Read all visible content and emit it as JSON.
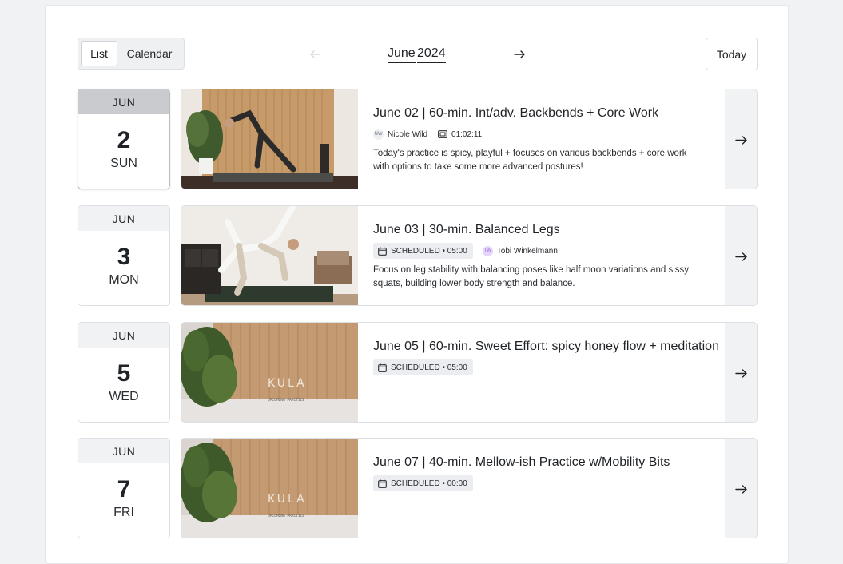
{
  "toolbar": {
    "view_list": "List",
    "view_calendar": "Calendar",
    "month": "June",
    "year": "2024",
    "today": "Today"
  },
  "colors": {
    "page_bg": "#f1f2f4",
    "selected_month_bg": "#c9cbcf",
    "badge_bg": "#ebedf0",
    "avatar_purple": "#e6d6fb"
  },
  "events": [
    {
      "month": "JUN",
      "day": "2",
      "weekday": "SUN",
      "selected": true,
      "title": "June 02 | 60-min. Int/adv. Backbends + Core Work",
      "instructor_initials": "NW",
      "instructor": "Nicole Wild",
      "duration": "01:02:11",
      "description": "Today's practice is spicy, playful + focuses on various backbends + core work with options to take some more advanced postures!",
      "thumbnail": "yoga-backbend-photo"
    },
    {
      "month": "JUN",
      "day": "3",
      "weekday": "MON",
      "selected": false,
      "title": "June 03 | 30-min. Balanced Legs",
      "scheduled": "SCHEDULED • 05:00",
      "instructor_initials": "TW",
      "instructor": "Tobi Winkelmann",
      "description": "Focus on leg stability with balancing poses like half moon variations and sissy squats, building lower body strength and balance.",
      "thumbnail": "yoga-balance-photo"
    },
    {
      "month": "JUN",
      "day": "5",
      "weekday": "WED",
      "selected": false,
      "title": "June 05 | 60-min. Sweet Effort: spicy honey flow + meditation",
      "scheduled": "SCHEDULED • 05:00",
      "thumbnail_logo": "KULA",
      "thumbnail_caption": "UPCOMING PRACTICE"
    },
    {
      "month": "JUN",
      "day": "7",
      "weekday": "FRI",
      "selected": false,
      "title": "June 07 | 40-min. Mellow-ish Practice w/Mobility Bits",
      "scheduled": "SCHEDULED • 00:00",
      "thumbnail_logo": "KULA",
      "thumbnail_caption": "UPCOMING PRACTICE"
    }
  ]
}
